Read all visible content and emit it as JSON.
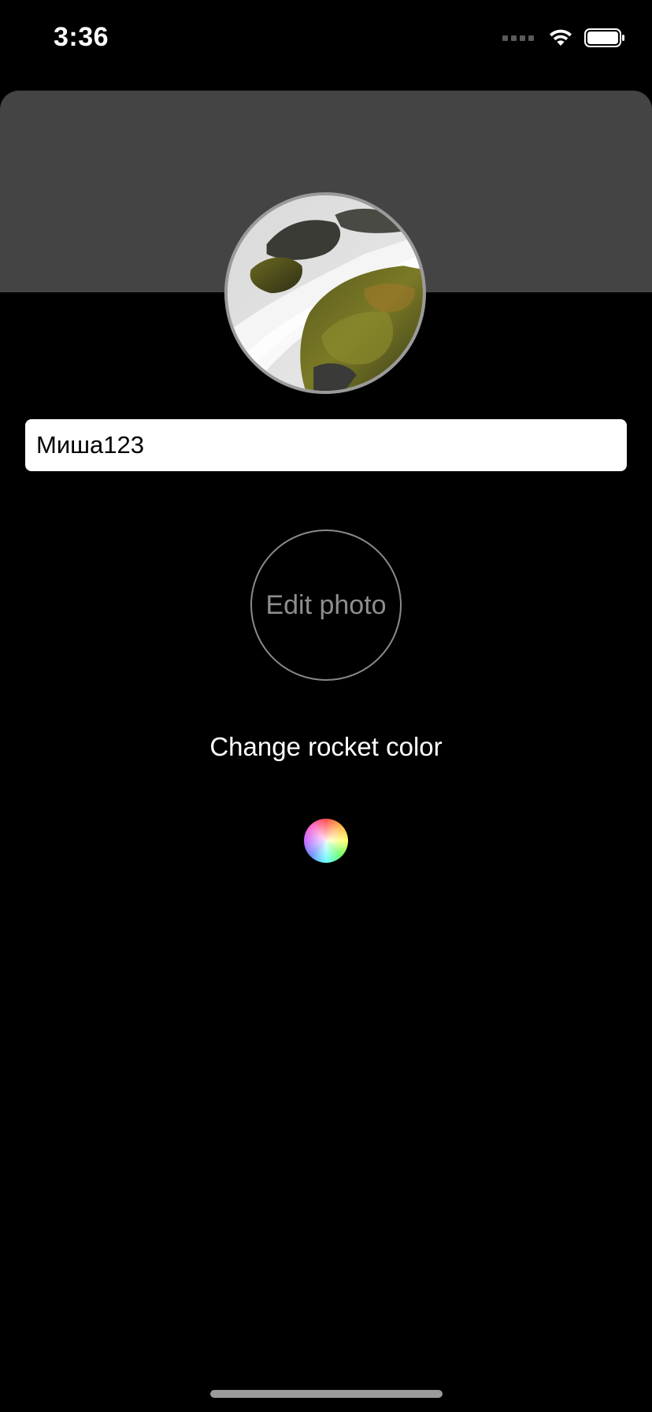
{
  "status_bar": {
    "time": "3:36",
    "icons": [
      "cellular-signal-icon",
      "wifi-icon",
      "battery-icon"
    ]
  },
  "profile": {
    "avatar_image": "waterfall-rocks-photo",
    "name_value": "Миша123",
    "name_placeholder": "",
    "edit_photo_label": "Edit photo",
    "rocket_color_label": "Change rocket color",
    "color_picker_icon": "color-wheel-icon"
  },
  "colors": {
    "background": "#000000",
    "header": "#444444",
    "avatar_border": "#9a9a9a",
    "edit_button_text": "#8e8e8e",
    "label_text": "#ffffff"
  }
}
